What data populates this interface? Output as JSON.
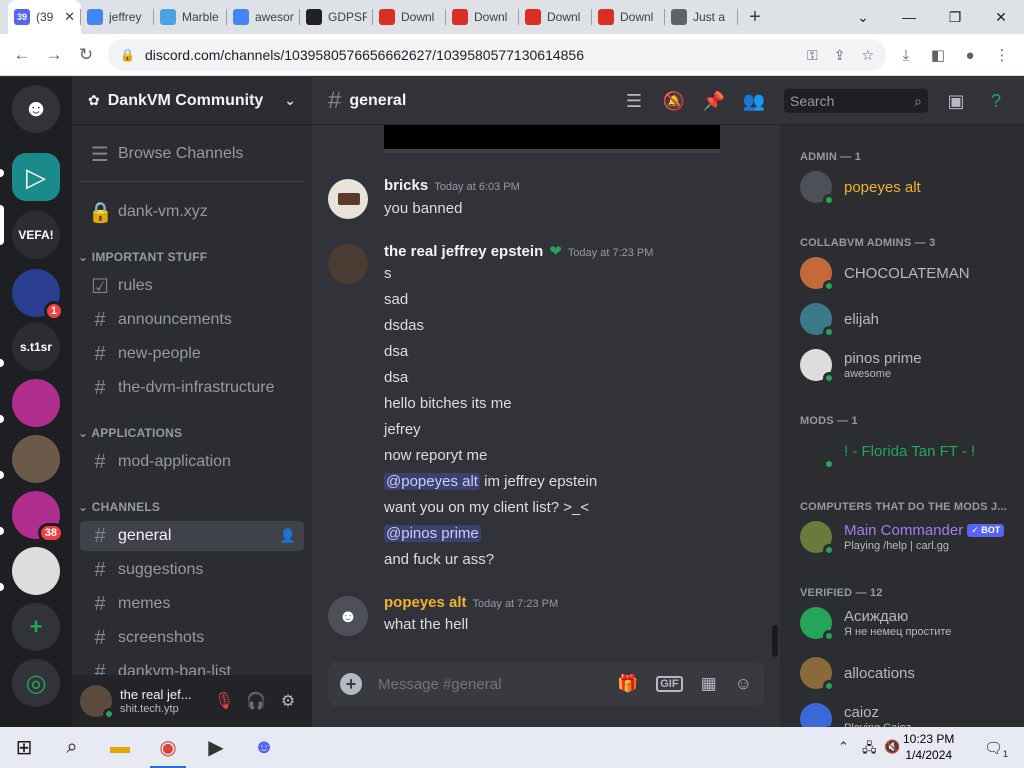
{
  "browser": {
    "tabs": [
      {
        "title": "(39",
        "favicon": "discord-icon",
        "color": "#5865f2",
        "active": true
      },
      {
        "title": "jeffrey",
        "favicon": "google-icon",
        "color": "#4285f4"
      },
      {
        "title": "Marble",
        "favicon": "snowflake-icon",
        "color": "#4aa3df"
      },
      {
        "title": "awesom",
        "favicon": "google-icon",
        "color": "#4285f4"
      },
      {
        "title": "GDPSF",
        "favicon": "shield-icon",
        "color": "#202124"
      },
      {
        "title": "Downl",
        "favicon": "download-icon",
        "color": "#d93025"
      },
      {
        "title": "Downl",
        "favicon": "download-icon",
        "color": "#d93025"
      },
      {
        "title": "Downl",
        "favicon": "download-icon",
        "color": "#d93025"
      },
      {
        "title": "Downl",
        "favicon": "download-icon",
        "color": "#d93025"
      },
      {
        "title": "Just a",
        "favicon": "globe-icon",
        "color": "#5f6368"
      }
    ],
    "tab_badge": "39",
    "url": "discord.com/channels/1039580576656662627/1039580577130614856"
  },
  "server": {
    "name": "DankVM Community",
    "browse_label": "Browse Channels",
    "top_channel": "dank-vm.xyz",
    "categories": [
      "IMPORTANT STUFF",
      "APPLICATIONS",
      "CHANNELS"
    ],
    "important": [
      "rules",
      "announcements",
      "new-people",
      "the-dvm-infrastructure"
    ],
    "applications": [
      "mod-application"
    ],
    "channels": [
      "general",
      "suggestions",
      "memes",
      "screenshots",
      "dankvm-ban-list"
    ]
  },
  "guilds": [
    {
      "label": "",
      "icon": "discord-home-icon",
      "color": "#313338"
    },
    {
      "label": "",
      "icon": "play-triangle-icon",
      "color": "#1a8a8a"
    },
    {
      "label": "VEFA!",
      "icon": "",
      "color": "#2b2d31"
    },
    {
      "label": "",
      "icon": "server-icon",
      "color": "#2a3f8f",
      "badge": "1"
    },
    {
      "label": "s.t1sr",
      "icon": "",
      "color": "#2b2d31"
    },
    {
      "label": "",
      "icon": "film-reel-icon",
      "color": "#b02e8e"
    },
    {
      "label": "",
      "icon": "photo-server-icon",
      "color": "#6b5a4a"
    },
    {
      "label": "",
      "icon": "film-reel-icon",
      "color": "#b02e8e",
      "badge": "38"
    },
    {
      "label": "",
      "icon": "raccoon-icon",
      "color": "#dddddd"
    },
    {
      "label": "+",
      "icon": "add-server-icon",
      "color": "#313338"
    },
    {
      "label": "",
      "icon": "compass-icon",
      "color": "#313338"
    }
  ],
  "user": {
    "name": "the real jef...",
    "status": "shit.tech.ytp"
  },
  "channel": {
    "name": "general",
    "search_placeholder": "Search"
  },
  "messages": [
    {
      "author": "bricks",
      "time": "Today at 6:03 PM",
      "author_color": "#f2f3f5",
      "avatar_color": "#e8e3d8",
      "lines": [
        "you banned"
      ]
    },
    {
      "author": "the real jeffrey epstein",
      "time": "Today at 7:23 PM",
      "author_color": "#f2f3f5",
      "avatar_color": "#4a3b33",
      "lines": [
        "s",
        "sad",
        "dsdas",
        "dsa",
        "dsa",
        "hello bitches its me",
        "jefrey",
        "now reporyt me"
      ],
      "mention1": "@popeyes alt",
      "mention1_rest": " im jeffrey epstein",
      "line10": "want you on my client list? >_<",
      "mention2": "@pinos prime",
      "line12": "and fuck ur ass?"
    },
    {
      "author": "popeyes alt",
      "time": "Today at 7:23 PM",
      "author_color": "#f0b232",
      "avatar_color": "#4e5058",
      "lines": [
        "what the hell"
      ]
    }
  ],
  "composer_placeholder": "Message #general",
  "members": {
    "groups": [
      {
        "label": "ADMIN — 1"
      },
      {
        "label": "COLLABVM ADMINS — 3"
      },
      {
        "label": "MODS — 1"
      },
      {
        "label": "COMPUTERS THAT DO THE MODS J..."
      },
      {
        "label": "VERIFIED — 12"
      }
    ],
    "list": [
      {
        "name": "popeyes alt",
        "color": "#f0b232",
        "status": "",
        "avatar": "#4e5058"
      },
      {
        "name": "CHOCOLATEMAN",
        "color": "#b5bac1",
        "status": "",
        "avatar": "#c46a3a"
      },
      {
        "name": "elijah",
        "color": "#b5bac1",
        "status": "",
        "avatar": "#3a7a8a"
      },
      {
        "name": "pinos prime",
        "color": "#b5bac1",
        "status": "awesome",
        "avatar": "#ddd"
      },
      {
        "name": "! - Florida Tan FT - !",
        "color": "#23a55a",
        "status": "",
        "avatar": "#2b2d31"
      },
      {
        "name": "Main Commander",
        "color": "#a57cf0",
        "status": "Playing /help | carl.gg",
        "avatar": "#6a7a3a",
        "bot": "✓ BOT"
      },
      {
        "name": "Асиждаю",
        "color": "#b5bac1",
        "status": "Я не немец простите",
        "avatar": "#23a55a"
      },
      {
        "name": "allocations",
        "color": "#b5bac1",
        "status": "",
        "avatar": "#8a6a3a"
      },
      {
        "name": "caioz",
        "color": "#b5bac1",
        "status": "Playing Caioz",
        "avatar": "#3a6ad8"
      }
    ]
  },
  "taskbar": {
    "time": "10:23 PM",
    "date": "1/4/2024",
    "notif_count": "1"
  }
}
